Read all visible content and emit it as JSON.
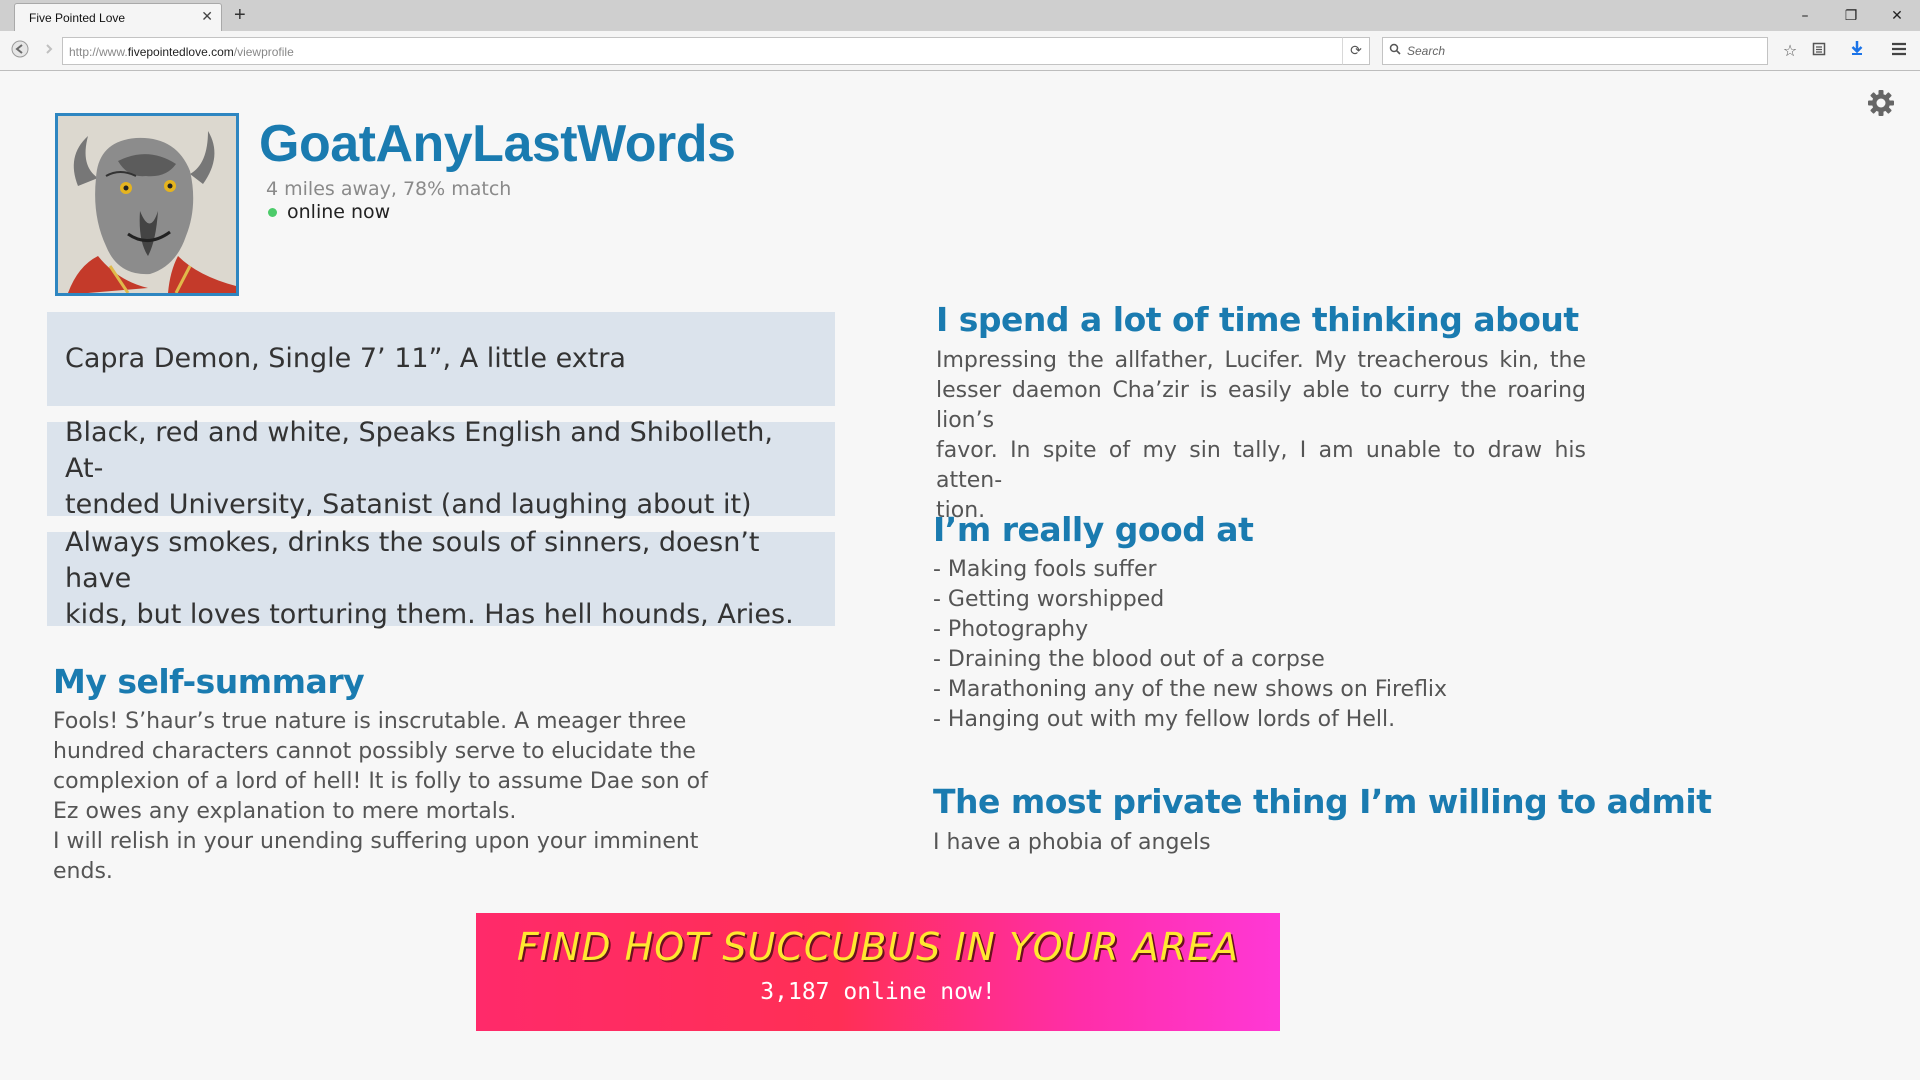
{
  "browser": {
    "tab_title": "Five Pointed Love",
    "tab_close": "✕",
    "new_tab": "+",
    "url_prefix": "http://www.",
    "url_host": "fivepointedlove.com",
    "url_path": "/viewprofile",
    "search_placeholder": "Search",
    "window_controls": [
      "–",
      "❐",
      "✕"
    ]
  },
  "profile": {
    "username": "GoatAnyLastWords",
    "meta": "4 miles away, 78% match",
    "status": "online now",
    "status_color": "#4ccb6a"
  },
  "info_boxes": [
    {
      "lines": [
        "Capra Demon, Single 7’ 11”, A little extra"
      ]
    },
    {
      "lines": [
        "Black, red and white, Speaks English and Shibolleth, At-",
        "tended University,  Satanist (and laughing about it)"
      ]
    },
    {
      "lines": [
        "Always smokes, drinks the souls of sinners, doesn’t have",
        "kids, but loves torturing them. Has hell hounds,  Aries."
      ]
    }
  ],
  "sections": {
    "self_summary": {
      "heading": "My self-summary",
      "lines": [
        "Fools! S’haur’s true nature is inscrutable. A meager three",
        "hundred characters cannot possibly serve to elucidate the",
        "complexion of a lord of hell! It is folly to assume Dae son of",
        "Ez owes any explanation to mere mortals.",
        "I will relish in your unending suffering upon your imminent",
        "ends."
      ]
    },
    "thinking_about": {
      "heading": "I spend a lot of time thinking about",
      "lines": [
        "Impressing the allfather, Lucifer. My treacherous kin, the",
        "lesser daemon Cha’zir is easily able to curry the roaring lion’s",
        "favor. In spite of my sin tally, I am unable to draw his atten-",
        "tion."
      ]
    },
    "good_at": {
      "heading": "I’m really good at",
      "items": [
        "- Making fools suffer",
        "- Getting worshipped",
        "- Photography",
        "- Draining the blood out of a corpse",
        "- Marathoning any of the new shows on Fireflix",
        "- Hanging out with my fellow lords of Hell."
      ]
    },
    "private_thing": {
      "heading": "The most private thing I’m willing to admit",
      "text": "I have a phobia of angels"
    }
  },
  "ad": {
    "headline": "FIND HOT SUCCUBUS IN YOUR AREA",
    "subline": "3,187 online now!"
  },
  "colors": {
    "accent": "#1a7bb0",
    "info_box_bg": "#dbe3ec",
    "ad_headline": "#ffe830"
  }
}
